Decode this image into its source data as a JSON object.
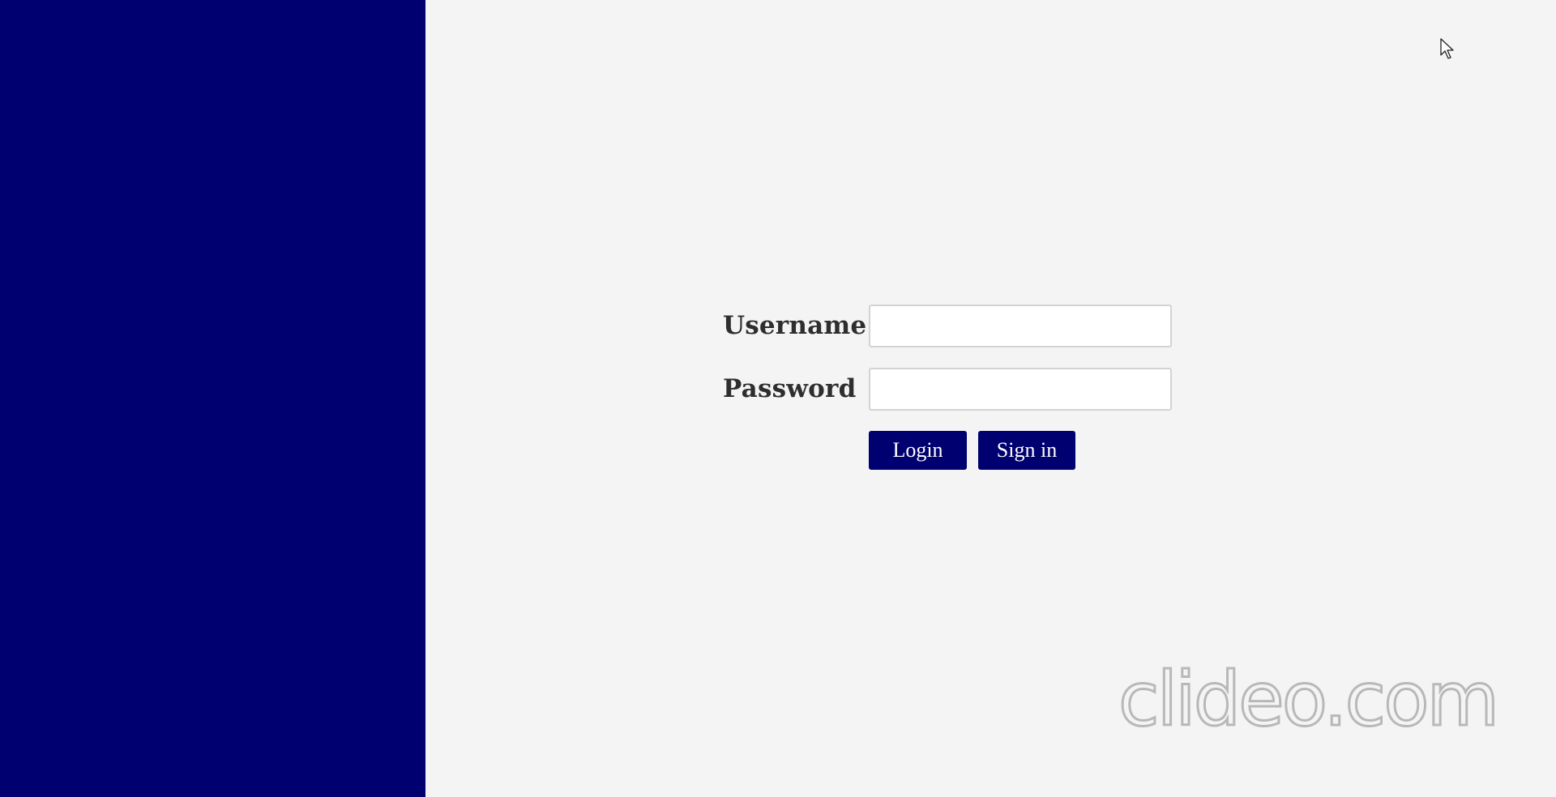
{
  "login_form": {
    "username_label": "Username",
    "password_label": "Password",
    "username_value": "",
    "password_value": "",
    "login_button": "Login",
    "signin_button": "Sign in"
  },
  "watermark": {
    "text": "clideo.com"
  },
  "colors": {
    "sidebar_bg": "#000070",
    "page_bg": "#f4f4f4",
    "button_bg": "#000070"
  }
}
